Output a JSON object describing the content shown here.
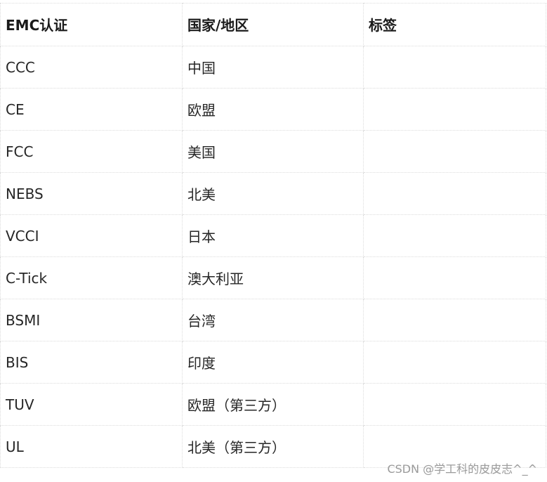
{
  "table": {
    "headers": [
      "EMC认证",
      "国家/地区",
      "标签"
    ],
    "rows": [
      {
        "cert": "CCC",
        "region": "中国",
        "label": ""
      },
      {
        "cert": "CE",
        "region": "欧盟",
        "label": ""
      },
      {
        "cert": "FCC",
        "region": "美国",
        "label": ""
      },
      {
        "cert": "NEBS",
        "region": "北美",
        "label": ""
      },
      {
        "cert": "VCCI",
        "region": "日本",
        "label": ""
      },
      {
        "cert": "C-Tick",
        "region": "澳大利亚",
        "label": ""
      },
      {
        "cert": "BSMI",
        "region": "台湾",
        "label": ""
      },
      {
        "cert": "BIS",
        "region": "印度",
        "label": ""
      },
      {
        "cert": "TUV",
        "region": "欧盟（第三方）",
        "label": ""
      },
      {
        "cert": "UL",
        "region": "北美（第三方）",
        "label": ""
      }
    ]
  },
  "watermark": "CSDN @学工科的皮皮志^_^"
}
